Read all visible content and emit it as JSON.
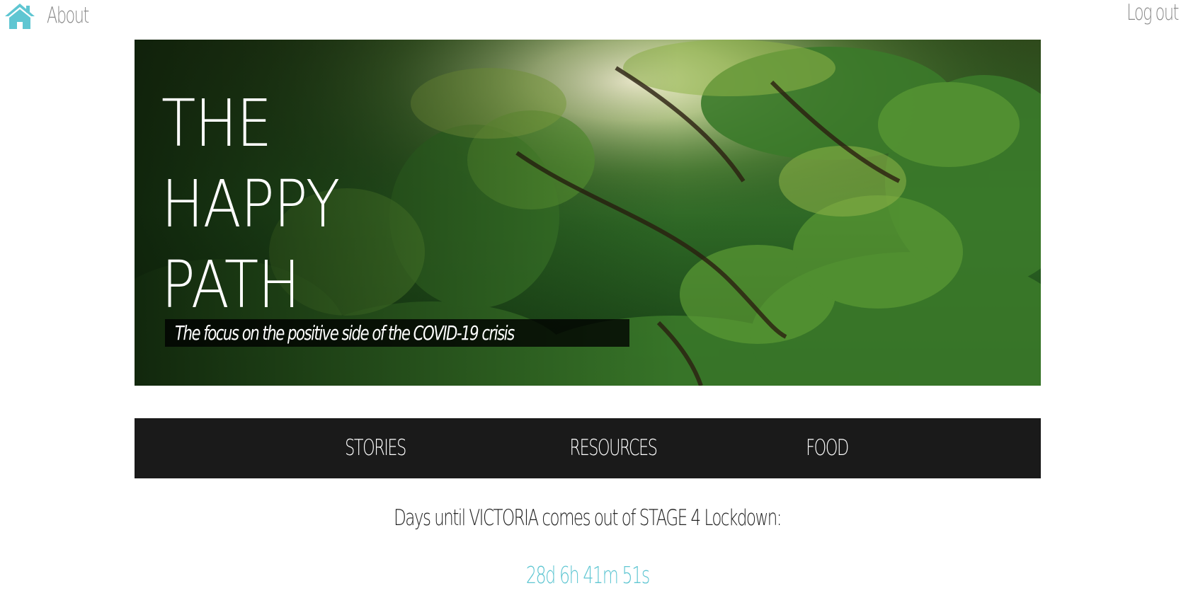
{
  "header": {
    "home_icon": "home-icon",
    "about_label": "About",
    "logout_label": "Log out",
    "link_color": "#8a8a8a",
    "home_icon_color": "#5fc6d2"
  },
  "hero": {
    "title_line1": "THE",
    "title_line2": "HAPPY",
    "title_line3": "PATH",
    "tagline": "The focus on the positive side of the COVID-19 crisis"
  },
  "nav": {
    "background": "#1a1a1a",
    "items": [
      {
        "label": "STORIES"
      },
      {
        "label": "RESOURCES"
      },
      {
        "label": "FOOD"
      }
    ]
  },
  "countdown": {
    "label": "Days until VICTORIA comes out of STAGE 4 Lockdown:",
    "value": "28d 6h 41m 51s",
    "value_color": "#5fc6d2"
  }
}
